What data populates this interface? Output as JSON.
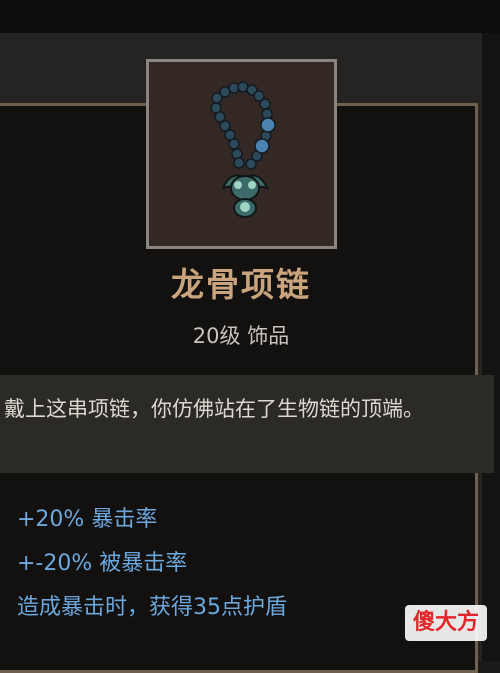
{
  "item": {
    "name": "龙骨项链",
    "type_line": "20级 饰品",
    "icon": "necklace-icon",
    "description": "戴上这串项链，你仿佛站在了生物链的顶端。"
  },
  "stats": [
    "+20% 暴击率",
    "+-20% 被暴击率",
    "造成暴击时，获得35点护盾"
  ],
  "watermark": "傻大方",
  "colors": {
    "name": "#c9a47c",
    "stat": "#6ca7dd",
    "border": "#6e6150",
    "desc_bg": "#2b2a27"
  }
}
